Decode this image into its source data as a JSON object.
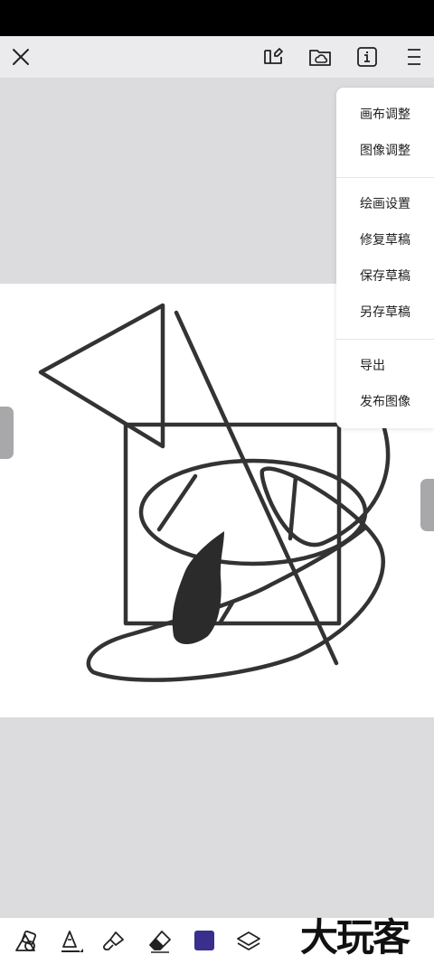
{
  "toolbar": {
    "close_icon": "close-icon",
    "share_icon": "sticker-icon",
    "cloud_icon": "cloud-folder-icon",
    "info_icon": "info-icon",
    "menu_icon": "menu-icon"
  },
  "menu": {
    "groups": [
      [
        "画布调整",
        "图像调整"
      ],
      [
        "绘画设置",
        "修复草稿",
        "保存草稿",
        "另存草稿"
      ],
      [
        "导出",
        "发布图像"
      ]
    ],
    "items": {
      "canvas_adjust": "画布调整",
      "image_adjust": "图像调整",
      "paint_settings": "绘画设置",
      "repair_draft": "修复草稿",
      "save_draft": "保存草稿",
      "save_draft_as": "另存草稿",
      "export": "导出",
      "publish_image": "发布图像"
    }
  },
  "bottom_tools": {
    "shapes_icon": "shapes-icon",
    "pen_icon": "pen-icon",
    "brush_icon": "brush-icon",
    "eraser_icon": "eraser-icon",
    "current_color": "#3a2f8c",
    "layers_icon": "layers-icon"
  },
  "watermark": {
    "text": "大玩客"
  },
  "colors": {
    "status_bar": "#000000",
    "toolbar_bg": "#ebebed",
    "workspace_bg": "#dcdcde",
    "canvas_bg": "#ffffff",
    "stroke": "#333333"
  }
}
